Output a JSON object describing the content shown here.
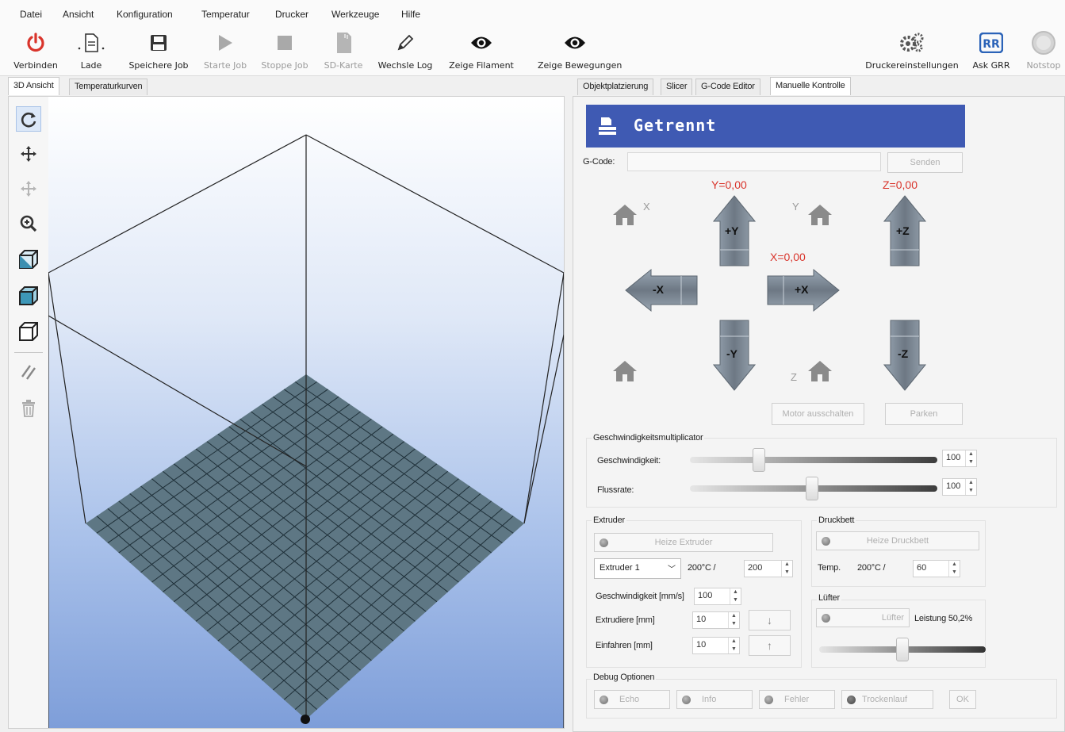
{
  "menu": [
    "Datei",
    "Ansicht",
    "Konfiguration",
    "Temperatur",
    "Drucker",
    "Werkzeuge",
    "Hilfe"
  ],
  "toolbar": {
    "connect": "Verbinden",
    "load": "Lade",
    "save_job": "Speichere Job",
    "start_job": "Starte Job",
    "stop_job": "Stoppe Job",
    "sd_card": "SD-Karte",
    "toggle_log": "Wechsle Log",
    "show_filament": "Zeige Filament",
    "show_moves": "Zeige Bewegungen",
    "printer_settings": "Druckereinstellungen",
    "ask_grr": "Ask GRR",
    "emergency_stop": "Notstop",
    "colors": {
      "connect": "#d9342b",
      "grr": "#2b63b8"
    }
  },
  "left_tabs": [
    "3D Ansicht",
    "Temperaturkurven"
  ],
  "right_tabs": [
    "Objektplatzierung",
    "Slicer",
    "G-Code Editor",
    "Manuelle Kontrolle"
  ],
  "status": {
    "text": "Getrennt",
    "color": "#3f5ab3"
  },
  "gcode": {
    "label": "G-Code:",
    "value": "",
    "send": "Senden"
  },
  "positions": {
    "x": "X=0,00",
    "y": "Y=0,00",
    "z": "Z=0,00"
  },
  "jog": {
    "plus_y": "+Y",
    "minus_y": "-Y",
    "plus_x": "+X",
    "minus_x": "-X",
    "plus_z": "+Z",
    "minus_z": "-Z",
    "home_x": "X",
    "home_y": "Y",
    "home_z": "Z"
  },
  "motor_off": "Motor ausschalten",
  "park": "Parken",
  "speed_group": {
    "title": "Geschwindigkeitsmultiplicator",
    "speed_label": "Geschwindigkeit:",
    "speed_value": "100",
    "flow_label": "Flussrate:",
    "flow_value": "100"
  },
  "extruder": {
    "title": "Extruder",
    "heat": "Heize Extruder",
    "select": "Extruder 1",
    "temp": "200°C /",
    "target": "200",
    "speed_label": "Geschwindigkeit [mm/s]",
    "speed_value": "100",
    "extrude_label": "Extrudiere [mm]",
    "extrude_value": "10",
    "retract_label": "Einfahren [mm]",
    "retract_value": "10"
  },
  "bed": {
    "title": "Druckbett",
    "heat": "Heize Druckbett",
    "temp_label": "Temp.",
    "temp": "200°C /",
    "target": "60"
  },
  "fan": {
    "title": "Lüfter",
    "button": "Lüfter",
    "power": "Leistung 50,2%",
    "level": 0.502
  },
  "debug": {
    "title": "Debug Optionen",
    "echo": "Echo",
    "info": "Info",
    "error": "Fehler",
    "dry_run": "Trockenlauf",
    "ok": "OK"
  }
}
